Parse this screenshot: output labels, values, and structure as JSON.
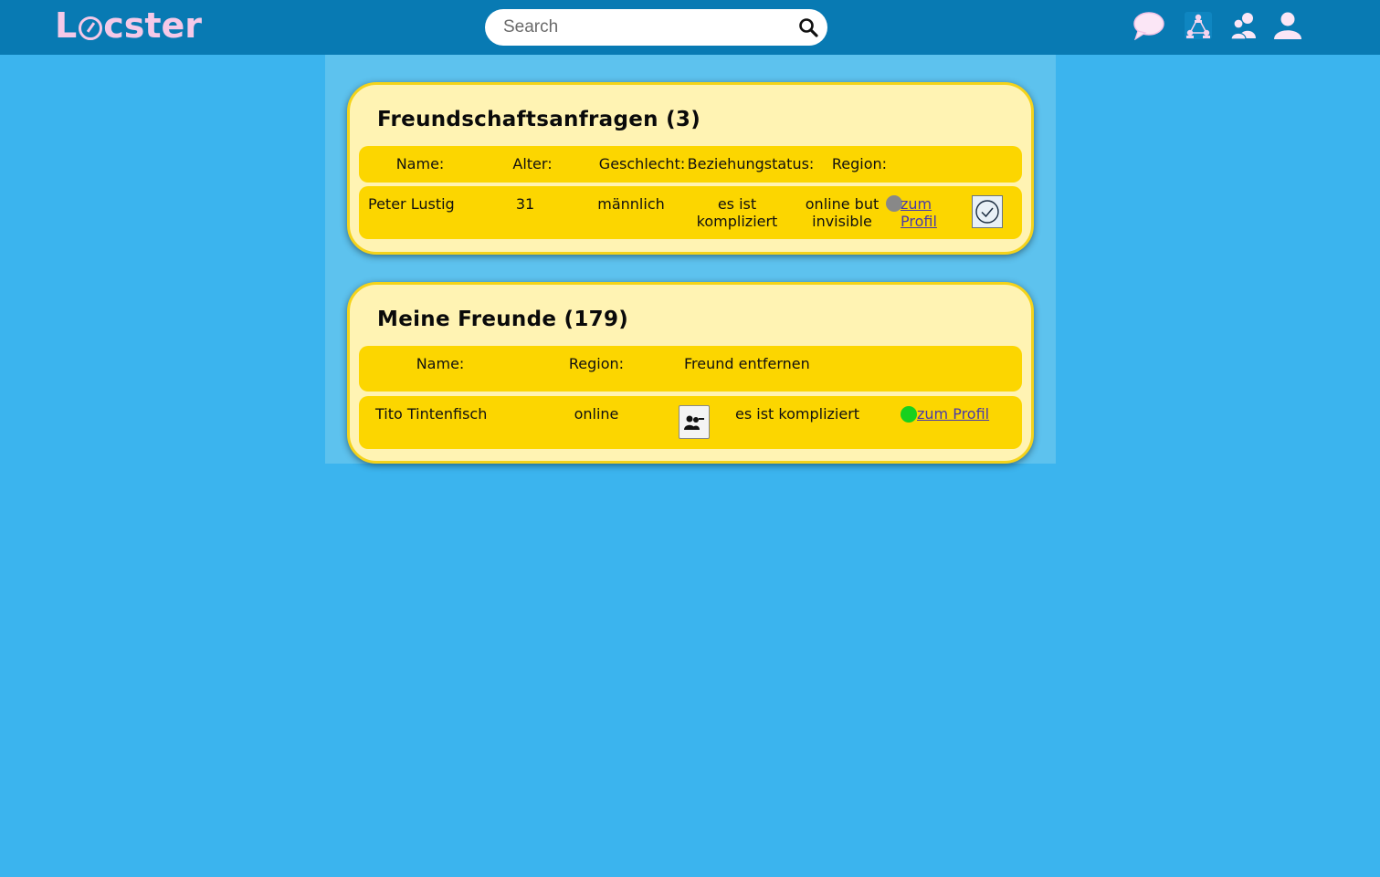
{
  "header": {
    "logo_text_pre": "L",
    "logo_text_post": "cster",
    "search_placeholder": "Search",
    "icons": [
      "chat-icon",
      "network-icon",
      "friends-icon",
      "profile-icon"
    ],
    "colors": {
      "navbar": "#087ab3",
      "background": "#3bb4ee",
      "logo": "#f4c9e8"
    }
  },
  "requests": {
    "title": "Freundschaftsanfragen (3)",
    "columns": {
      "name": "Name:",
      "age": "Alter:",
      "gender": "Geschlecht:",
      "relationship": "Beziehungstatus:",
      "region": "Region:"
    },
    "rows": [
      {
        "name": "Peter Lustig",
        "age": "31",
        "gender": "männlich",
        "relationship_line1": "es ist",
        "relationship_line2": "kompliziert",
        "status_line1": "online but",
        "status_line2": "invisible",
        "status_color": "#888888",
        "link_line1": "zum",
        "link_line2": "Profil"
      }
    ]
  },
  "friends": {
    "title": "Meine Freunde (179)",
    "columns": {
      "name": "Name:",
      "region": "Region:",
      "remove": "Freund entfernen"
    },
    "rows": [
      {
        "name": "Tito Tintenfisch",
        "status": "online",
        "relationship": "es ist kompliziert",
        "status_color": "#17d11e",
        "link": "zum Profil"
      }
    ]
  }
}
